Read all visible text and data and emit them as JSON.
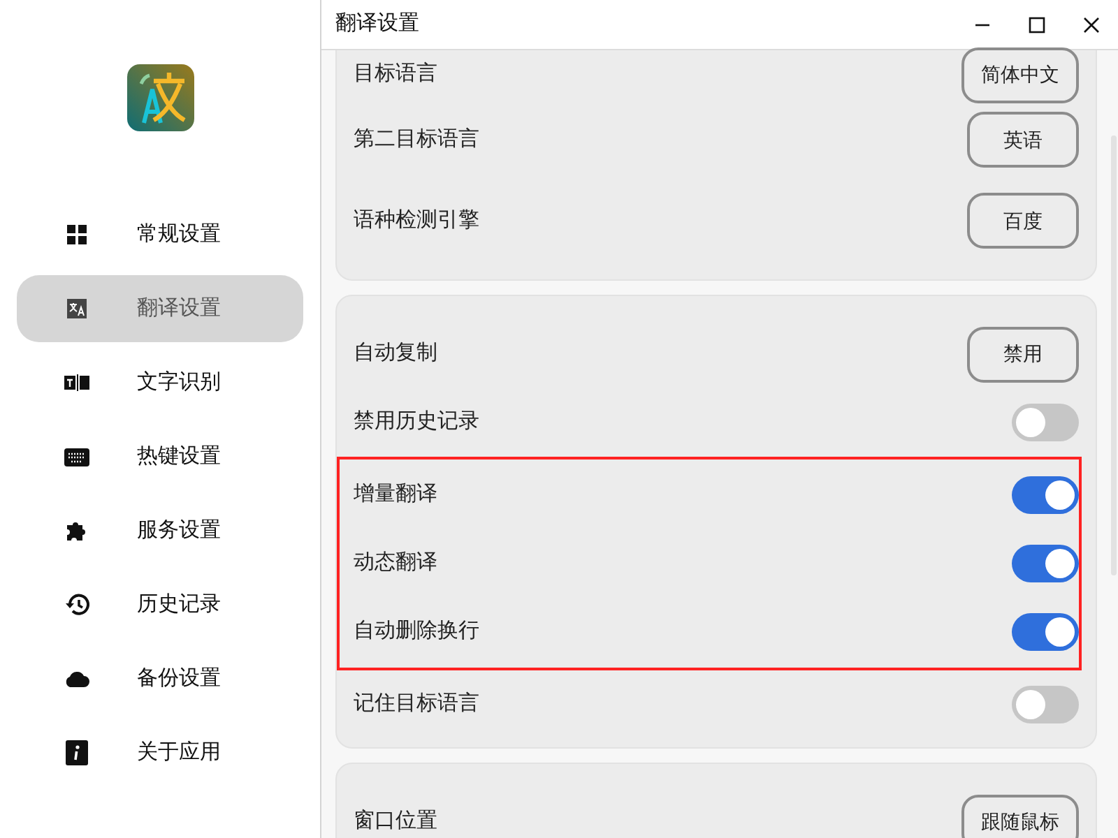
{
  "window": {
    "title": "翻译设置"
  },
  "sidebar": {
    "items": [
      {
        "label": "常规设置",
        "selected": false
      },
      {
        "label": "翻译设置",
        "selected": true
      },
      {
        "label": "文字识别",
        "selected": false
      },
      {
        "label": "热键设置",
        "selected": false
      },
      {
        "label": "服务设置",
        "selected": false
      },
      {
        "label": "历史记录",
        "selected": false
      },
      {
        "label": "备份设置",
        "selected": false
      },
      {
        "label": "关于应用",
        "selected": false
      }
    ]
  },
  "cards": [
    {
      "rows": [
        {
          "kind": "select",
          "label": "目标语言",
          "value": "简体中文",
          "highlighted": false
        },
        {
          "kind": "select",
          "label": "第二目标语言",
          "value": "英语",
          "highlighted": false
        },
        {
          "kind": "select",
          "label": "语种检测引擎",
          "value": "百度",
          "highlighted": false
        }
      ]
    },
    {
      "rows": [
        {
          "kind": "select",
          "label": "自动复制",
          "value": "禁用",
          "highlighted": false
        },
        {
          "kind": "switch",
          "label": "禁用历史记录",
          "on": false,
          "highlighted": false
        },
        {
          "kind": "switch",
          "label": "增量翻译",
          "on": true,
          "highlighted": true
        },
        {
          "kind": "switch",
          "label": "动态翻译",
          "on": true,
          "highlighted": true
        },
        {
          "kind": "switch",
          "label": "自动删除换行",
          "on": true,
          "highlighted": true
        },
        {
          "kind": "switch",
          "label": "记住目标语言",
          "on": false,
          "highlighted": false
        }
      ]
    },
    {
      "rows": [
        {
          "kind": "select",
          "label": "窗口位置",
          "value": "跟随鼠标",
          "highlighted": false
        }
      ]
    }
  ]
}
